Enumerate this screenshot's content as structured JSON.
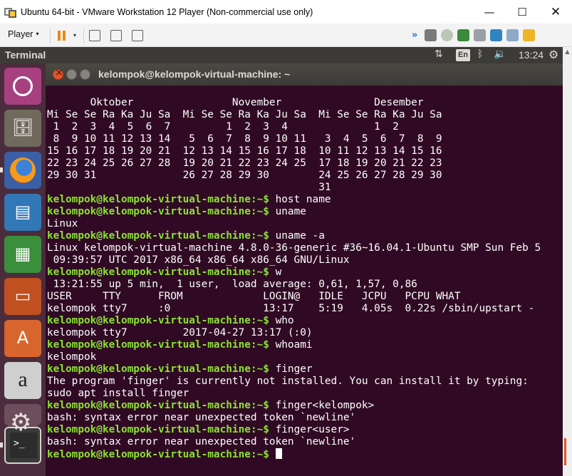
{
  "window": {
    "title": "Ubuntu 64-bit - VMware Workstation 12 Player (Non-commercial use only)",
    "minimize": "—",
    "maximize": "☐",
    "close": "✕"
  },
  "vm_toolbar": {
    "player_menu": "Player",
    "caret": "▾",
    "chevron": "»",
    "device_icons": [
      "hard-disk-icon",
      "cd-dvd-icon",
      "network-icon",
      "printer-icon",
      "usb-icon",
      "display-icon",
      "message-icon"
    ]
  },
  "topbar": {
    "app_name": "Terminal",
    "keyboard": "En",
    "clock": "13:24"
  },
  "terminal": {
    "title": "kelompok@kelompok-virtual-machine: ~",
    "prompt": "kelompok@kelompok-virtual-machine",
    "prompt_suffix": ":~$ ",
    "calendar_lines": [
      "       Oktober                November               Desember",
      "Mi Se Se Ra Ka Ju Sa  Mi Se Se Ra Ka Ju Sa  Mi Se Se Ra Ka Ju Sa",
      " 1  2  3  4  5  6  7         1  2  3  4              1  2",
      " 8  9 10 11 12 13 14   5  6  7  8  9 10 11   3  4  5  6  7  8  9",
      "15 16 17 18 19 20 21  12 13 14 15 16 17 18  10 11 12 13 14 15 16",
      "22 23 24 25 26 27 28  19 20 21 22 23 24 25  17 18 19 20 21 22 23",
      "29 30 31              26 27 28 29 30        24 25 26 27 28 29 30",
      "                                            31"
    ],
    "session": [
      {
        "cmd": "host name",
        "output": []
      },
      {
        "cmd": "uname",
        "output": [
          "Linux"
        ]
      },
      {
        "cmd": "uname -a",
        "output": [
          "Linux kelompok-virtual-machine 4.8.0-36-generic #36~16.04.1-Ubuntu SMP Sun Feb 5",
          " 09:39:57 UTC 2017 x86_64 x86_64 x86_64 GNU/Linux"
        ]
      },
      {
        "cmd": "w",
        "output": [
          " 13:21:55 up 5 min,  1 user,  load average: 0,61, 1,57, 0,86",
          "USER     TTY      FROM             LOGIN@   IDLE   JCPU   PCPU WHAT",
          "kelompok tty7     :0               13:17    5:19   4.05s  0.22s /sbin/upstart -"
        ]
      },
      {
        "cmd": "who",
        "output": [
          "kelompok tty7         2017-04-27 13:17 (:0)"
        ]
      },
      {
        "cmd": "whoami",
        "output": [
          "kelompok"
        ]
      },
      {
        "cmd": "finger",
        "output": [
          "The program 'finger' is currently not installed. You can install it by typing:",
          "sudo apt install finger"
        ]
      },
      {
        "cmd": "finger<kelompok>",
        "output": [
          "bash: syntax error near unexpected token `newline'"
        ]
      },
      {
        "cmd": "finger<user>",
        "output": [
          "bash: syntax error near unexpected token `newline'"
        ]
      }
    ],
    "final_cmd": ""
  },
  "launcher": {
    "items": [
      "ubuntu-dash-icon",
      "files-icon",
      "firefox-icon",
      "writer-icon",
      "calc-icon",
      "impress-icon",
      "software-center-icon",
      "amazon-icon",
      "system-settings-icon",
      "terminal-icon"
    ],
    "amazon_glyph": "a",
    "terminal_glyph": ">_"
  },
  "colors": {
    "terminal_bg": "#300a24",
    "prompt_green": "#8ae234",
    "launcher_bg": "#4b2c3c",
    "topbar_bg": "#3c3b37",
    "close_orange": "#e4542b"
  }
}
